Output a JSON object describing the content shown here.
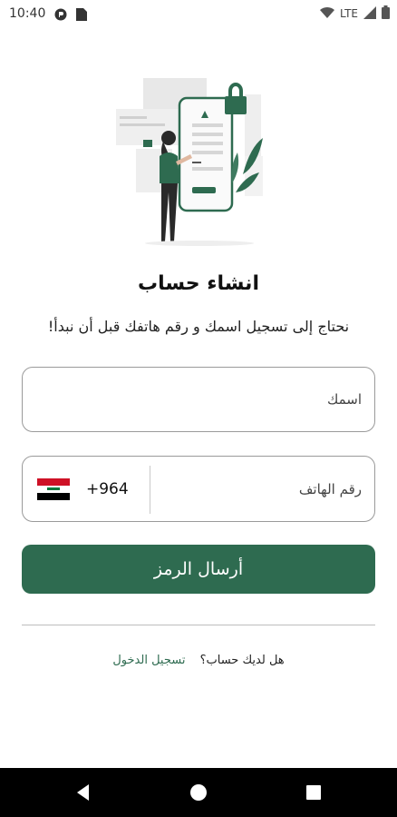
{
  "status_bar": {
    "time": "10:40",
    "network": "LTE",
    "icons": [
      "app-icon",
      "sim-card-icon",
      "wifi-icon",
      "signal-icon",
      "battery-icon"
    ]
  },
  "header": {
    "title": "انشاء حساب",
    "subtitle": "نحتاج إلى تسجيل اسمك و رقم هاتفك قبل أن نبدأ!"
  },
  "form": {
    "name_placeholder": "اسمك",
    "phone_placeholder": "رقم الهاتف",
    "country_code": "+964",
    "country_flag": "iraq-flag-icon",
    "submit_label": "أرسال الرمز"
  },
  "footer": {
    "question": "هل لديك حساب؟",
    "login_link": "تسجيل الدخول"
  },
  "colors": {
    "primary": "#2e6b50",
    "field_border": "#9a9a9a",
    "navbar": "#000000"
  }
}
